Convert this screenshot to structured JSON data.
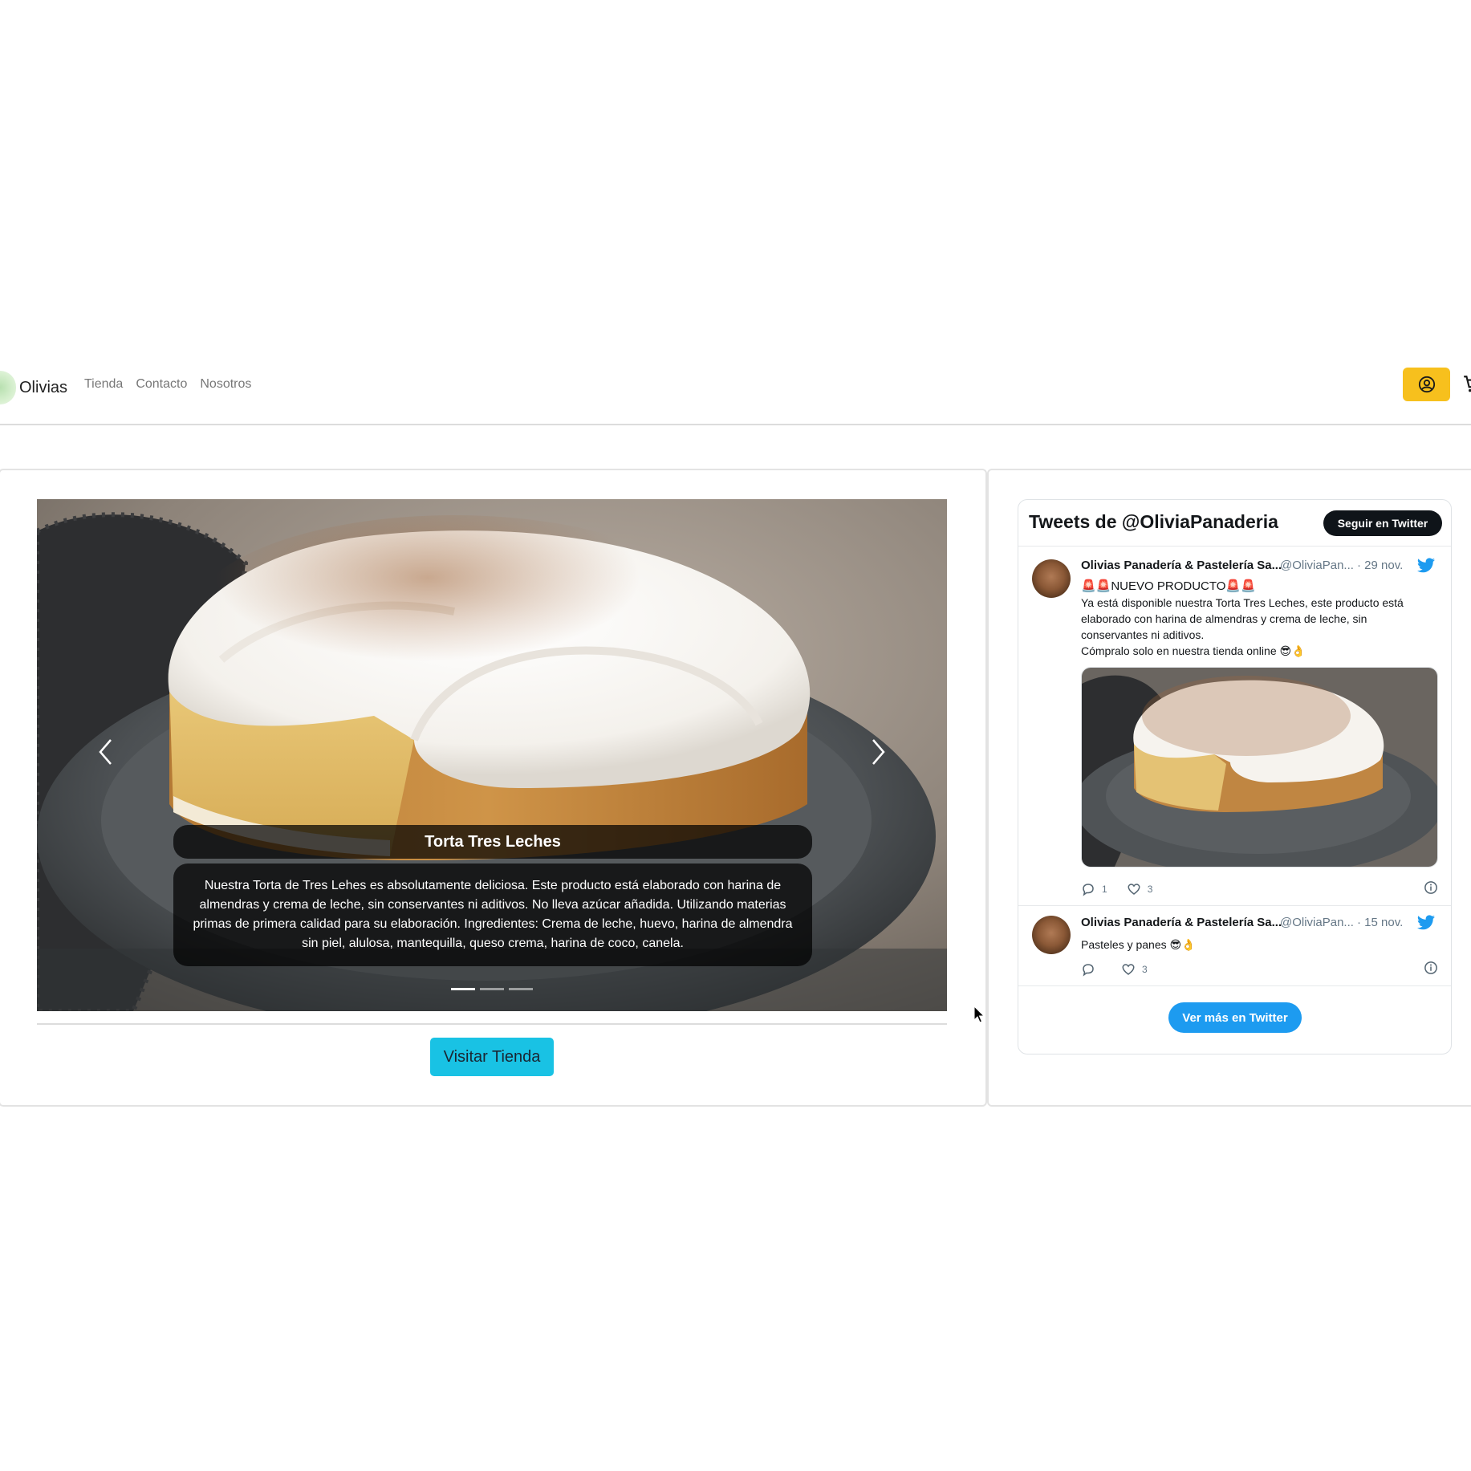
{
  "navbar": {
    "brand": "Olivias",
    "links": [
      "Tienda",
      "Contacto",
      "Nosotros"
    ],
    "user_icon": "user-circle-icon",
    "cart_icon": "cart-icon",
    "accent_color": "#f7c01d"
  },
  "carousel": {
    "caption_title": "Torta Tres Leches",
    "caption_text": "Nuestra Torta de Tres Lehes es absolutamente deliciosa. Este producto está elaborado con harina de almendras y crema de leche, sin conservantes ni aditivos. No lleva azúcar añadida. Utilizando materias primas de primera calidad para su elaboración. Ingredientes: Crema de leche, huevo, harina de almendra sin piel, alulosa, mantequilla, queso crema, harina de coco, canela.",
    "slide_count": 3,
    "active_slide": 1,
    "image_subject": "tres-leches-cake-photo"
  },
  "visit_button": "Visitar Tienda",
  "twitter": {
    "title": "Tweets de @OliviaPanaderia",
    "follow_label": "Seguir en Twitter",
    "more_label": "Ver más en Twitter",
    "tweets": [
      {
        "name": "Olivias Panadería & Pastelería Sa...",
        "handle": "@OliviaPan...",
        "date": "· 29 nov.",
        "lines": [
          "🚨🚨NUEVO PRODUCTO🚨🚨",
          "Ya está disponible nuestra Torta Tres Leches, este producto está",
          "elaborado con harina de almendras y crema de leche, sin",
          "conservantes ni aditivos.",
          "Cómpralo solo en nuestra tienda online 😎👌"
        ],
        "replies": "1",
        "likes": "3"
      },
      {
        "name": "Olivias Panadería & Pastelería Sa...",
        "handle": "@OliviaPan...",
        "date": "· 15 nov.",
        "lines": [
          "Pasteles y panes 😎👌"
        ],
        "replies": "",
        "likes": "3"
      }
    ],
    "brand_color": "#1d9bf0"
  },
  "colors": {
    "visit_button": "#19c2e4",
    "follow_button": "#0f1419"
  }
}
